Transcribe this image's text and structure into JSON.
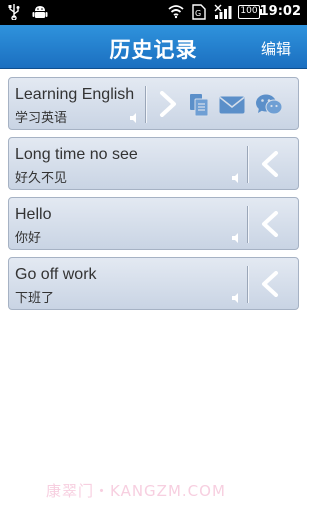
{
  "status_bar": {
    "time": "19:02",
    "battery": "100",
    "icons": [
      "usb-icon",
      "android-icon",
      "wifi-icon",
      "sim-icon",
      "signal-icon",
      "battery-icon"
    ]
  },
  "header": {
    "title": "历史记录",
    "edit_label": "编辑"
  },
  "history": [
    {
      "english": "Learning English",
      "chinese": "学习英语",
      "expanded": true,
      "actions": [
        "copy-icon",
        "mail-icon",
        "wechat-icon"
      ]
    },
    {
      "english": "Long time no see",
      "chinese": "好久不见",
      "expanded": false
    },
    {
      "english": "Hello",
      "chinese": "你好",
      "expanded": false
    },
    {
      "english": "Go off work",
      "chinese": "下班了",
      "expanded": false
    }
  ],
  "watermark": "康翠门・KANGZM.COM",
  "colors": {
    "title_bar": "#1f7fd0",
    "item_bg": "#d5deea",
    "icon_blue": "#5b8fc9",
    "watermark": "#f7cfe0"
  }
}
